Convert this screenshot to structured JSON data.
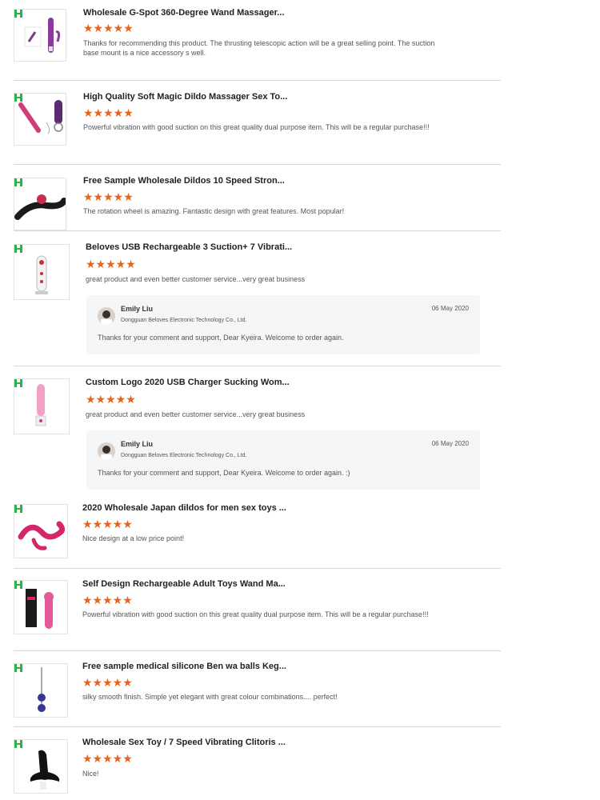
{
  "colors": {
    "star": "#e8631b",
    "badge": "#2bb24c",
    "divider": "#d8d8d8"
  },
  "reviews": [
    {
      "title": "Wholesale G-Spot 360-Degree Wand Massager...",
      "stars": "★★★★★",
      "comment": "Thanks for recommending this product. The thrusting telescopic action will be a great selling point. The suction base mount is a nice accessory s well.",
      "image_icon": "purple-rabbit-vibrator-icon"
    },
    {
      "title": "High Quality Soft Magic Dildo Massager Sex To...",
      "stars": "★★★★★",
      "comment": "Powerful vibration with good suction on this great quality dual purpose item. This will be a regular purchase!!!",
      "image_icon": "wand-massager-icon"
    },
    {
      "title": "Free Sample Wholesale Dildos 10 Speed Stron...",
      "stars": "★★★★★",
      "comment": "The rotation wheel is amazing. Fantastic design with great features. Most popular!",
      "image_icon": "rotating-vibrator-icon"
    },
    {
      "title": "Beloves USB Rechargeable 3 Suction+ 7 Vibrati...",
      "stars": "★★★★★",
      "comment": "great product and even better customer service...very great business",
      "image_icon": "clear-suction-toy-icon",
      "reply": {
        "name": "Emily Liu",
        "company": "Dongguan Beloves Electronic Technology Co., Ltd.",
        "date": "06 May 2020",
        "text": "Thanks for your comment and support, Dear Kyeira. Welcome to order again."
      }
    },
    {
      "title": "Custom Logo 2020 USB Charger Sucking Wom...",
      "stars": "★★★★★",
      "comment": "great product and even better customer service...very great business",
      "image_icon": "pink-thrusting-toy-icon",
      "reply": {
        "name": "Emily Liu",
        "company": "Dongguan Beloves Electronic Technology Co., Ltd.",
        "date": "06 May 2020",
        "text": "Thanks for your comment and support, Dear Kyeira. Welcome to order again. :)"
      }
    },
    {
      "title": "2020 Wholesale Japan dildos for men sex toys ...",
      "stars": "★★★★★",
      "comment": "Nice design at a low price point!",
      "image_icon": "pink-curved-toy-icon"
    },
    {
      "title": "Self Design Rechargeable Adult Toys Wand Ma...",
      "stars": "★★★★★",
      "comment": "Powerful vibration with good suction on this great quality dual purpose item. This will be a regular purchase!!!",
      "image_icon": "boxed-wand-icon"
    },
    {
      "title": "Free sample medical silicone Ben wa balls Keg...",
      "stars": "★★★★★",
      "comment": "silky smooth finish. Simple yet elegant with great colour combinations.... perfect!",
      "image_icon": "kegel-balls-icon"
    },
    {
      "title": "Wholesale Sex Toy / 7 Speed Vibrating Clitoris ...",
      "stars": "★★★★★",
      "comment": "Nice!",
      "image_icon": "black-plug-icon"
    }
  ]
}
